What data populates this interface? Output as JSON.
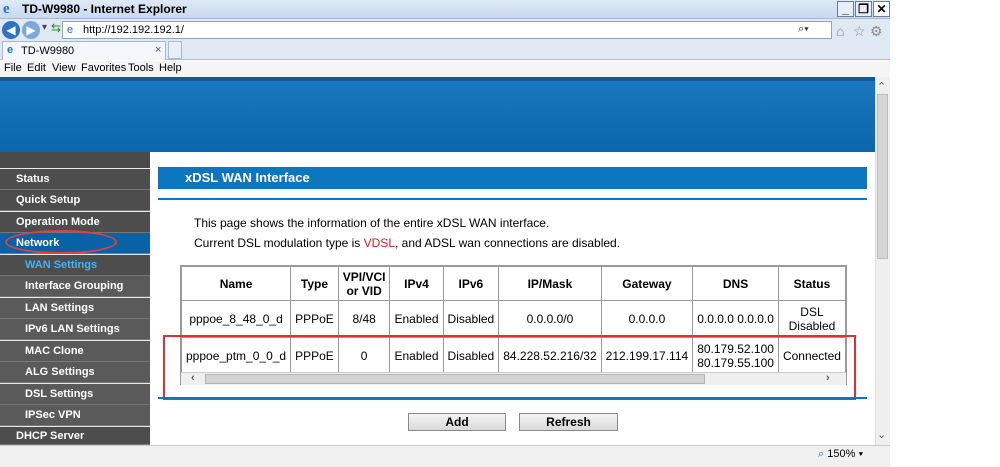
{
  "window": {
    "title": "TD-W9980 - Internet Explorer",
    "min": "_",
    "max": "❐",
    "close": "✕"
  },
  "address": {
    "url": "http://192.192.192.1/",
    "search_glyph": "⌕▾"
  },
  "tab": {
    "title": "TD-W9980",
    "close": "×"
  },
  "menu": [
    "File",
    "Edit",
    "View",
    "Favorites",
    "Tools",
    "Help"
  ],
  "nav": {
    "items": [
      {
        "label": "Status"
      },
      {
        "label": "Quick Setup"
      },
      {
        "label": "Operation Mode"
      },
      {
        "label": "Network"
      },
      {
        "label": "WAN Settings"
      },
      {
        "label": "Interface Grouping"
      },
      {
        "label": "LAN Settings"
      },
      {
        "label": "IPv6 LAN Settings"
      },
      {
        "label": "MAC Clone"
      },
      {
        "label": "ALG Settings"
      },
      {
        "label": "DSL Settings"
      },
      {
        "label": "IPSec VPN"
      },
      {
        "label": "DHCP Server"
      }
    ]
  },
  "section": {
    "title": "xDSL WAN Interface",
    "desc1": "This page shows the information of the entire xDSL WAN interface.",
    "desc2_a": "Current DSL modulation type is ",
    "desc2_b": "VDSL",
    "desc2_c": ", and ADSL wan connections are disabled."
  },
  "table": {
    "headers": [
      "Name",
      "Type",
      "VPI/VCI\nor VID",
      "IPv4",
      "IPv6",
      "IP/Mask",
      "Gateway",
      "DNS",
      "Status"
    ],
    "rows": [
      [
        "pppoe_8_48_0_d",
        "PPPoE",
        "8/48",
        "Enabled",
        "Disabled",
        "0.0.0.0/0",
        "0.0.0.0",
        "0.0.0.0 0.0.0.0",
        "DSL\nDisabled"
      ],
      [
        "pppoe_ptm_0_0_d",
        "PPPoE",
        "0",
        "Enabled",
        "Disabled",
        "84.228.52.216/32",
        "212.199.17.114",
        "80.179.52.100\n80.179.55.100",
        "Connected"
      ]
    ]
  },
  "buttons": {
    "add": "Add",
    "refresh": "Refresh"
  },
  "status": {
    "zoom": "150%"
  },
  "colors": {
    "accent": "#0d76c0",
    "highlight": "#e03030",
    "vdsl": "#d42020"
  }
}
